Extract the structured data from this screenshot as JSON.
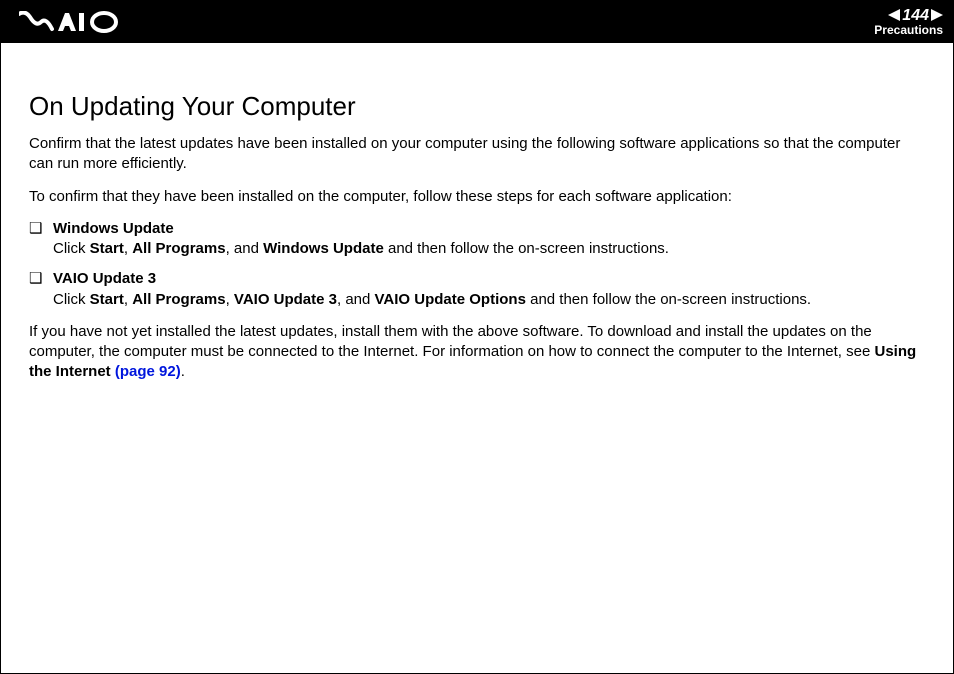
{
  "header": {
    "page_number": "144",
    "section": "Precautions",
    "n_glyph": "n",
    "N_glyph": "N"
  },
  "title": "On Updating Your Computer",
  "intro1": "Confirm that the latest updates have been installed on your computer using the following software applications so that the computer can run more efficiently.",
  "intro2": "To confirm that they have been installed on the computer, follow these steps for each software application:",
  "bullet_glyph": "❑",
  "items": [
    {
      "name": "Windows Update",
      "pre": "Click ",
      "b1": "Start",
      "sep1": ", ",
      "b2": "All Programs",
      "sep2": ", and ",
      "b3": "Windows Update",
      "tail": " and then follow the on-screen instructions."
    },
    {
      "name": "VAIO Update 3",
      "pre": "Click ",
      "b1": "Start",
      "sep1": ", ",
      "b2": "All Programs",
      "sep2": ", ",
      "b3": "VAIO Update 3",
      "sep3": ", and ",
      "b4": "VAIO Update Options",
      "tail": " and then follow the on-screen instructions."
    }
  ],
  "outro_pre": "If you have not yet installed the latest updates, install them with the above software. To download and install the updates on the computer, the computer must be connected to the Internet. For information on how to connect the computer to the Internet, see ",
  "outro_bold": "Using the Internet ",
  "outro_link": "(page 92)",
  "outro_post": "."
}
